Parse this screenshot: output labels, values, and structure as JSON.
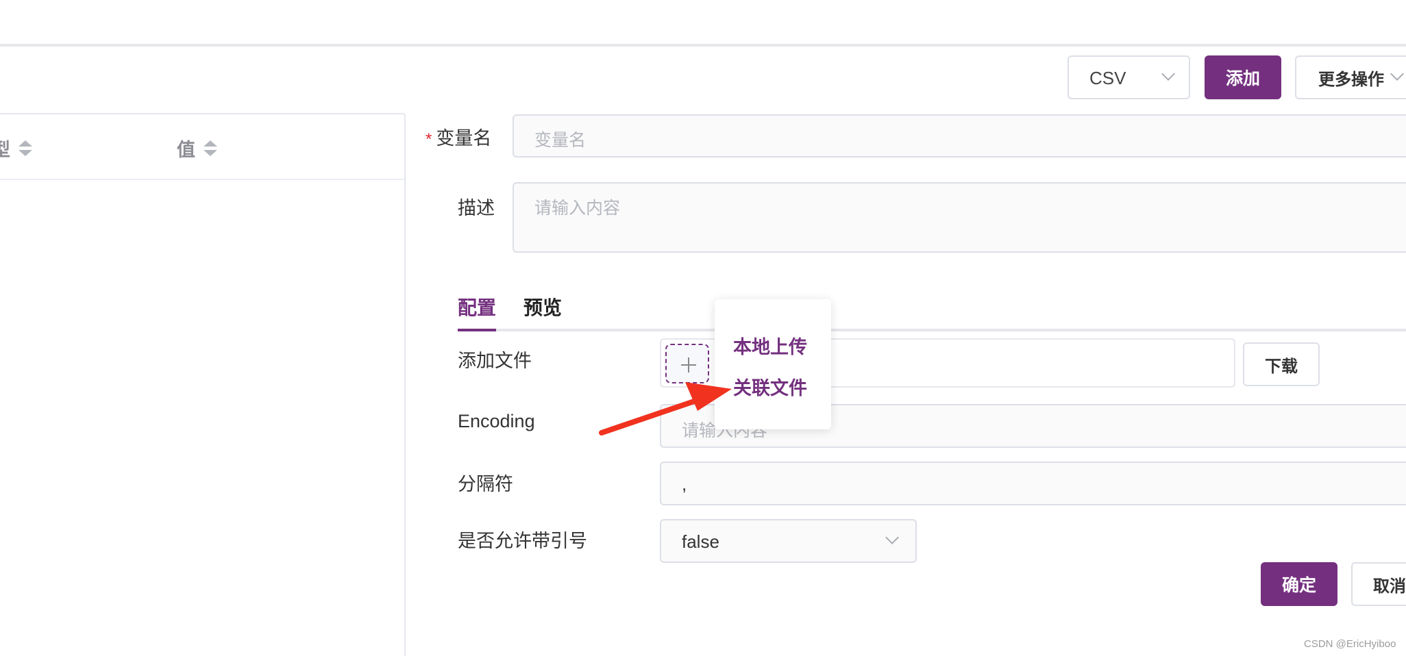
{
  "toolbar": {
    "format_select": "CSV",
    "add_label": "添加",
    "more_label": "更多操作"
  },
  "table": {
    "col_type_partial": "型",
    "col_value": "值"
  },
  "form": {
    "name_required": "*",
    "name_label": "变量名",
    "name_placeholder": "变量名",
    "desc_label": "描述",
    "desc_placeholder": "请输入内容",
    "tabs": [
      "配置",
      "预览"
    ],
    "add_file_label": "添加文件",
    "download_label": "下载",
    "encoding_label": "Encoding",
    "encoding_placeholder": "请输入内容",
    "delimiter_label": "分隔符",
    "delimiter_value": ",",
    "quote_label": "是否允许带引号",
    "quote_value": "false",
    "confirm_label": "确定",
    "cancel_label": "取消"
  },
  "dropdown": {
    "items": [
      "本地上传",
      "关联文件"
    ]
  },
  "watermark": "CSDN @EricHyiboo",
  "colors": {
    "accent": "#74307f",
    "arrow": "#f0321f"
  }
}
